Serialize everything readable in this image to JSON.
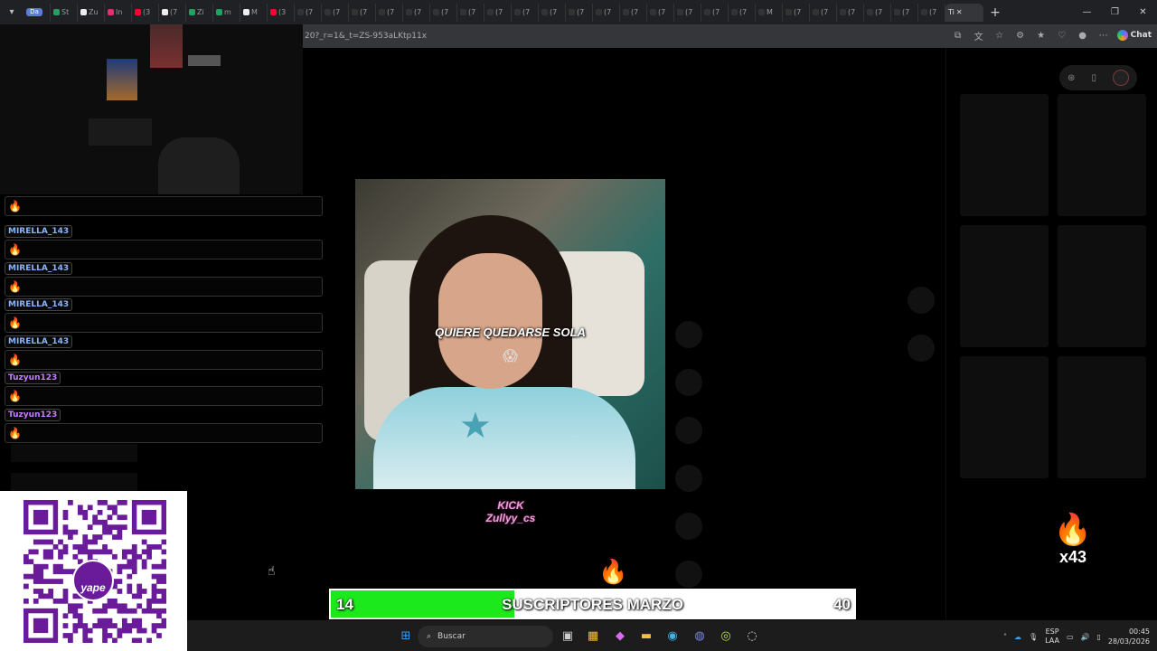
{
  "browser": {
    "first_tab_label": "Da",
    "tab_labels": [
      "St",
      "Zu",
      "In",
      "(3",
      "(7",
      "Zi",
      "m",
      "M",
      "(3",
      "(7",
      "(7",
      "(7",
      "(7",
      "(7",
      "(7",
      "(7",
      "(7",
      "(7",
      "(7",
      "(7",
      "(7",
      "(7",
      "(7",
      "(7",
      "(7",
      "(7",
      "M",
      "(7",
      "(7",
      "(7",
      "(7",
      "(7",
      "(7"
    ],
    "active_tab_label": "Ti",
    "close_glyph": "✕",
    "new_tab_glyph": "+",
    "address_text": "20?_r=1&_t=ZS-953aLKtp11x",
    "chat_label": "Chat"
  },
  "chat": {
    "messages": [
      {
        "user": "MIRELLA_143",
        "color": "#8ab4f8",
        "emote": "🔥"
      },
      {
        "user": "MIRELLA_143",
        "color": "#8ab4f8",
        "emote": "🔥"
      },
      {
        "user": "MIRELLA_143",
        "color": "#8ab4f8",
        "emote": "🔥"
      },
      {
        "user": "MIRELLA_143",
        "color": "#8ab4f8",
        "emote": "🔥"
      },
      {
        "user": "Tuzyun123",
        "color": "#c77dff",
        "emote": "🔥"
      },
      {
        "user": "Tuzyun123",
        "color": "#c77dff",
        "emote": "🔥"
      }
    ],
    "top_emote": "🔥"
  },
  "qr": {
    "brand": "yape",
    "colors": {
      "dark": "#6a1b9a",
      "accent": "#2bb3a3"
    }
  },
  "video": {
    "caption": "QUIERE QUEDARSE SOLA",
    "caption_emoji": "😱",
    "star_glyph": "★"
  },
  "kick_logo": {
    "line1": "KICK",
    "line2": "Zullyy_cs"
  },
  "fire_emote": {
    "emoji": "🔥",
    "multiplier": "x43"
  },
  "fire_emote_small": "🔥",
  "sub_goal": {
    "title": "SUSCRIPTORES MARZO",
    "current": 14,
    "current_label": "14",
    "goal": 40,
    "goal_label": "40",
    "progress_fraction": 0.35,
    "fill_color": "#1ce91c"
  },
  "taskbar": {
    "search_placeholder": "Buscar",
    "lang_line1": "ESP",
    "lang_line2": "LAA",
    "time": "00:45",
    "date": "28/03/2026"
  },
  "right_panel": {
    "avatar_icon": "avatar"
  }
}
